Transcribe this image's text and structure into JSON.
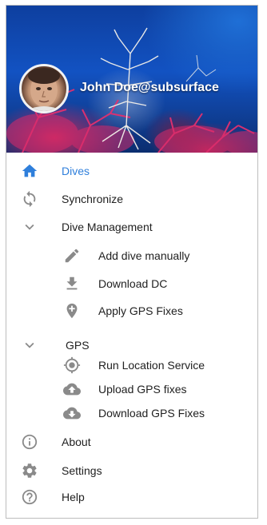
{
  "header": {
    "user_name": "John Doe@subsurface"
  },
  "menu": {
    "dives": {
      "label": "Dives",
      "icon": "home-icon",
      "active": true
    },
    "synchronize": {
      "label": "Synchronize",
      "icon": "sync-icon"
    },
    "dive_management": {
      "label": "Dive Management",
      "icon": "chevron-down-icon",
      "expanded": true,
      "items": [
        {
          "label": "Add dive manually",
          "icon": "pencil-icon"
        },
        {
          "label": "Download DC",
          "icon": "download-icon"
        },
        {
          "label": "Apply GPS Fixes",
          "icon": "location-add-icon"
        }
      ]
    },
    "gps": {
      "label": "GPS",
      "icon": "chevron-down-icon",
      "expanded": true,
      "items": [
        {
          "label": "Run Location Service",
          "icon": "gps-target-icon"
        },
        {
          "label": "Upload GPS fixes",
          "icon": "cloud-upload-icon"
        },
        {
          "label": "Download GPS Fixes",
          "icon": "cloud-download-icon"
        }
      ]
    },
    "about": {
      "label": "About",
      "icon": "info-icon"
    },
    "settings": {
      "label": "Settings",
      "icon": "gear-icon"
    },
    "help": {
      "label": "Help",
      "icon": "help-icon"
    }
  },
  "colors": {
    "accent": "#2f7fdb",
    "icon_gray": "#8a8a8a",
    "text": "#212121"
  }
}
